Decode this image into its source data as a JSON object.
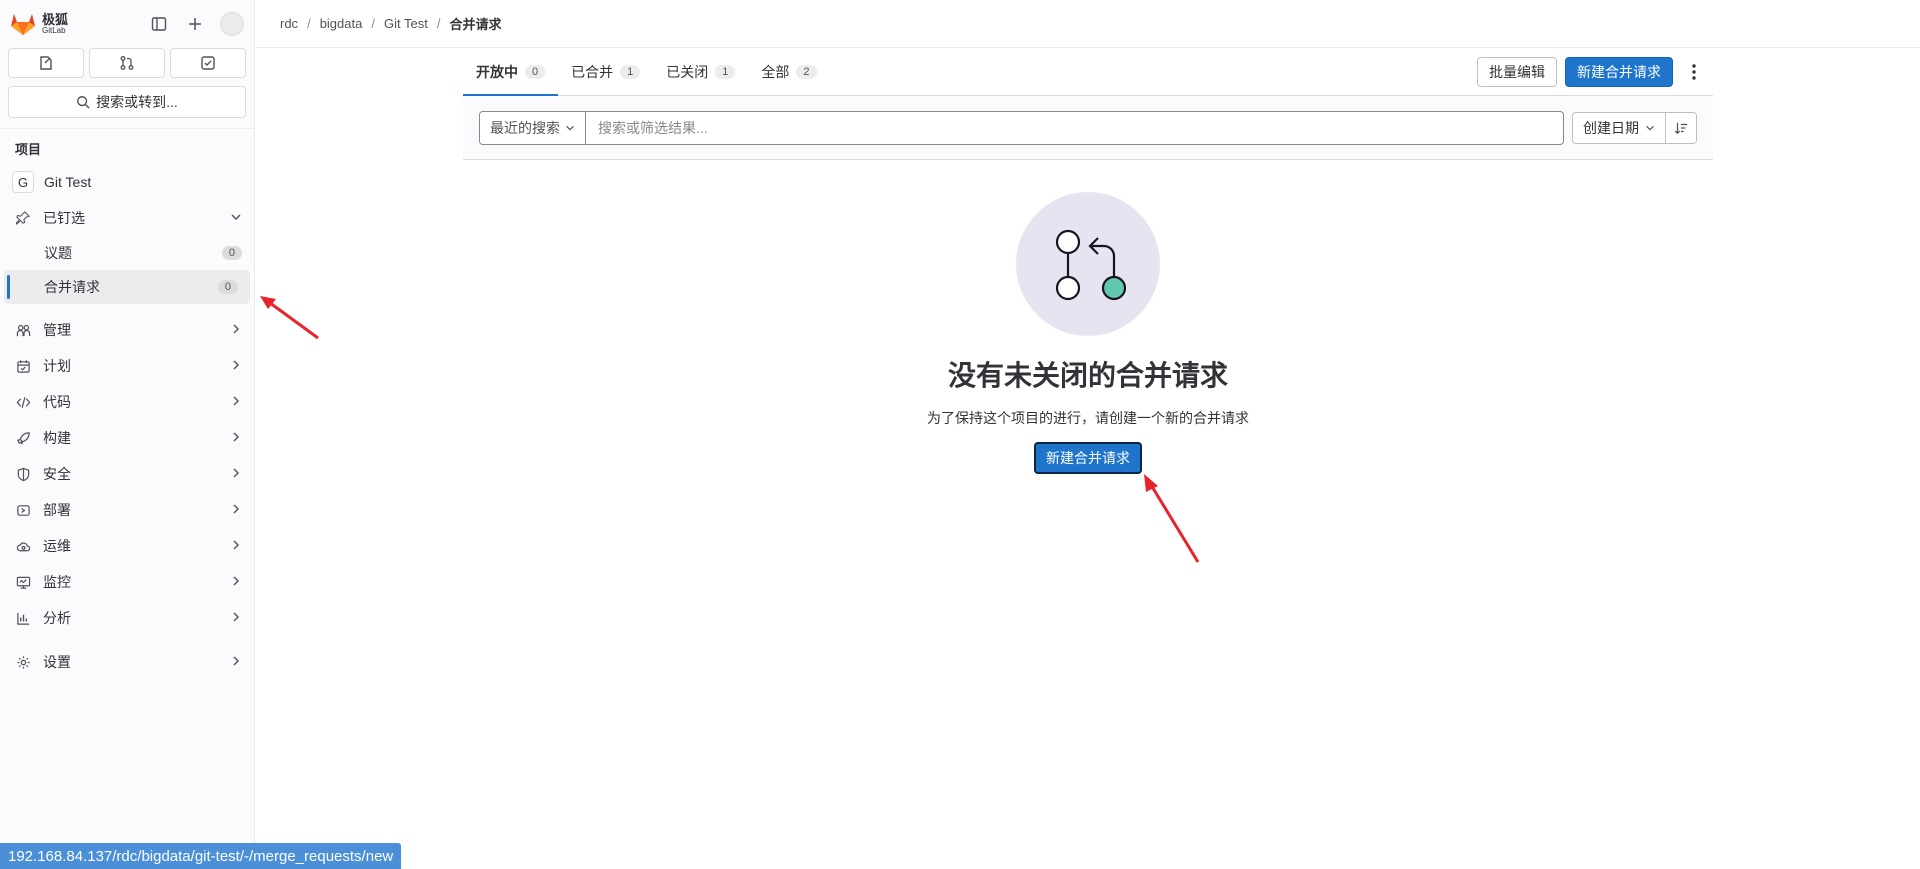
{
  "brand": {
    "name": "极狐",
    "sub": "GitLab"
  },
  "sidebar": {
    "search_label": "搜索或转到...",
    "section_title": "项目",
    "project": {
      "initial": "G",
      "name": "Git Test"
    },
    "pinned": {
      "label": "已钉选",
      "items": [
        {
          "label": "议题",
          "count": "0"
        },
        {
          "label": "合并请求",
          "count": "0"
        }
      ]
    },
    "nav": [
      {
        "label": "管理",
        "icon": "users-icon"
      },
      {
        "label": "计划",
        "icon": "calendar-icon"
      },
      {
        "label": "代码",
        "icon": "code-icon"
      },
      {
        "label": "构建",
        "icon": "rocket-icon"
      },
      {
        "label": "安全",
        "icon": "shield-icon"
      },
      {
        "label": "部署",
        "icon": "deploy-icon"
      },
      {
        "label": "运维",
        "icon": "cloud-icon"
      },
      {
        "label": "监控",
        "icon": "monitor-icon"
      },
      {
        "label": "分析",
        "icon": "chart-icon"
      }
    ],
    "settings_label": "设置"
  },
  "breadcrumb": [
    "rdc",
    "bigdata",
    "Git Test",
    "合并请求"
  ],
  "tabs": [
    {
      "label": "开放中",
      "count": "0"
    },
    {
      "label": "已合并",
      "count": "1"
    },
    {
      "label": "已关闭",
      "count": "1"
    },
    {
      "label": "全部",
      "count": "2"
    }
  ],
  "actions": {
    "bulk_edit": "批量编辑",
    "new_mr": "新建合并请求"
  },
  "filter": {
    "recent": "最近的搜索",
    "placeholder": "搜索或筛选结果...",
    "sort": "创建日期"
  },
  "empty_state": {
    "title": "没有未关闭的合并请求",
    "description": "为了保持这个项目的进行，请创建一个新的合并请求",
    "button": "新建合并请求"
  },
  "status_url": "192.168.84.137/rdc/bigdata/git-test/-/merge_requests/new",
  "colors": {
    "accent": "#1f75cb",
    "annotation": "#e8242a",
    "illustration_bg": "#e7e4f2",
    "teal": "#63c8ad"
  }
}
